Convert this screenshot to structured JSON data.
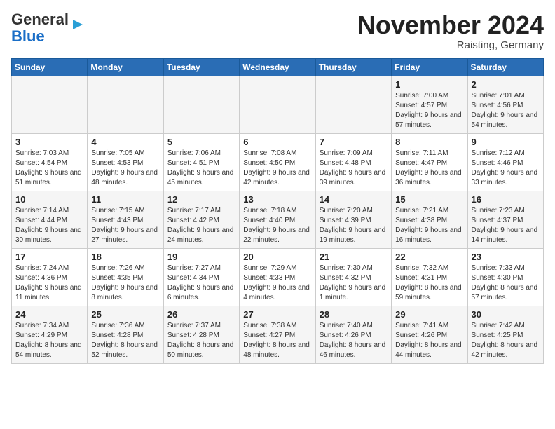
{
  "header": {
    "logo_line1": "General",
    "logo_line2": "Blue",
    "month_title": "November 2024",
    "location": "Raisting, Germany"
  },
  "days_of_week": [
    "Sunday",
    "Monday",
    "Tuesday",
    "Wednesday",
    "Thursday",
    "Friday",
    "Saturday"
  ],
  "weeks": [
    [
      {
        "day": "",
        "info": ""
      },
      {
        "day": "",
        "info": ""
      },
      {
        "day": "",
        "info": ""
      },
      {
        "day": "",
        "info": ""
      },
      {
        "day": "",
        "info": ""
      },
      {
        "day": "1",
        "info": "Sunrise: 7:00 AM\nSunset: 4:57 PM\nDaylight: 9 hours and 57 minutes."
      },
      {
        "day": "2",
        "info": "Sunrise: 7:01 AM\nSunset: 4:56 PM\nDaylight: 9 hours and 54 minutes."
      }
    ],
    [
      {
        "day": "3",
        "info": "Sunrise: 7:03 AM\nSunset: 4:54 PM\nDaylight: 9 hours and 51 minutes."
      },
      {
        "day": "4",
        "info": "Sunrise: 7:05 AM\nSunset: 4:53 PM\nDaylight: 9 hours and 48 minutes."
      },
      {
        "day": "5",
        "info": "Sunrise: 7:06 AM\nSunset: 4:51 PM\nDaylight: 9 hours and 45 minutes."
      },
      {
        "day": "6",
        "info": "Sunrise: 7:08 AM\nSunset: 4:50 PM\nDaylight: 9 hours and 42 minutes."
      },
      {
        "day": "7",
        "info": "Sunrise: 7:09 AM\nSunset: 4:48 PM\nDaylight: 9 hours and 39 minutes."
      },
      {
        "day": "8",
        "info": "Sunrise: 7:11 AM\nSunset: 4:47 PM\nDaylight: 9 hours and 36 minutes."
      },
      {
        "day": "9",
        "info": "Sunrise: 7:12 AM\nSunset: 4:46 PM\nDaylight: 9 hours and 33 minutes."
      }
    ],
    [
      {
        "day": "10",
        "info": "Sunrise: 7:14 AM\nSunset: 4:44 PM\nDaylight: 9 hours and 30 minutes."
      },
      {
        "day": "11",
        "info": "Sunrise: 7:15 AM\nSunset: 4:43 PM\nDaylight: 9 hours and 27 minutes."
      },
      {
        "day": "12",
        "info": "Sunrise: 7:17 AM\nSunset: 4:42 PM\nDaylight: 9 hours and 24 minutes."
      },
      {
        "day": "13",
        "info": "Sunrise: 7:18 AM\nSunset: 4:40 PM\nDaylight: 9 hours and 22 minutes."
      },
      {
        "day": "14",
        "info": "Sunrise: 7:20 AM\nSunset: 4:39 PM\nDaylight: 9 hours and 19 minutes."
      },
      {
        "day": "15",
        "info": "Sunrise: 7:21 AM\nSunset: 4:38 PM\nDaylight: 9 hours and 16 minutes."
      },
      {
        "day": "16",
        "info": "Sunrise: 7:23 AM\nSunset: 4:37 PM\nDaylight: 9 hours and 14 minutes."
      }
    ],
    [
      {
        "day": "17",
        "info": "Sunrise: 7:24 AM\nSunset: 4:36 PM\nDaylight: 9 hours and 11 minutes."
      },
      {
        "day": "18",
        "info": "Sunrise: 7:26 AM\nSunset: 4:35 PM\nDaylight: 9 hours and 8 minutes."
      },
      {
        "day": "19",
        "info": "Sunrise: 7:27 AM\nSunset: 4:34 PM\nDaylight: 9 hours and 6 minutes."
      },
      {
        "day": "20",
        "info": "Sunrise: 7:29 AM\nSunset: 4:33 PM\nDaylight: 9 hours and 4 minutes."
      },
      {
        "day": "21",
        "info": "Sunrise: 7:30 AM\nSunset: 4:32 PM\nDaylight: 9 hours and 1 minute."
      },
      {
        "day": "22",
        "info": "Sunrise: 7:32 AM\nSunset: 4:31 PM\nDaylight: 8 hours and 59 minutes."
      },
      {
        "day": "23",
        "info": "Sunrise: 7:33 AM\nSunset: 4:30 PM\nDaylight: 8 hours and 57 minutes."
      }
    ],
    [
      {
        "day": "24",
        "info": "Sunrise: 7:34 AM\nSunset: 4:29 PM\nDaylight: 8 hours and 54 minutes."
      },
      {
        "day": "25",
        "info": "Sunrise: 7:36 AM\nSunset: 4:28 PM\nDaylight: 8 hours and 52 minutes."
      },
      {
        "day": "26",
        "info": "Sunrise: 7:37 AM\nSunset: 4:28 PM\nDaylight: 8 hours and 50 minutes."
      },
      {
        "day": "27",
        "info": "Sunrise: 7:38 AM\nSunset: 4:27 PM\nDaylight: 8 hours and 48 minutes."
      },
      {
        "day": "28",
        "info": "Sunrise: 7:40 AM\nSunset: 4:26 PM\nDaylight: 8 hours and 46 minutes."
      },
      {
        "day": "29",
        "info": "Sunrise: 7:41 AM\nSunset: 4:26 PM\nDaylight: 8 hours and 44 minutes."
      },
      {
        "day": "30",
        "info": "Sunrise: 7:42 AM\nSunset: 4:25 PM\nDaylight: 8 hours and 42 minutes."
      }
    ]
  ]
}
